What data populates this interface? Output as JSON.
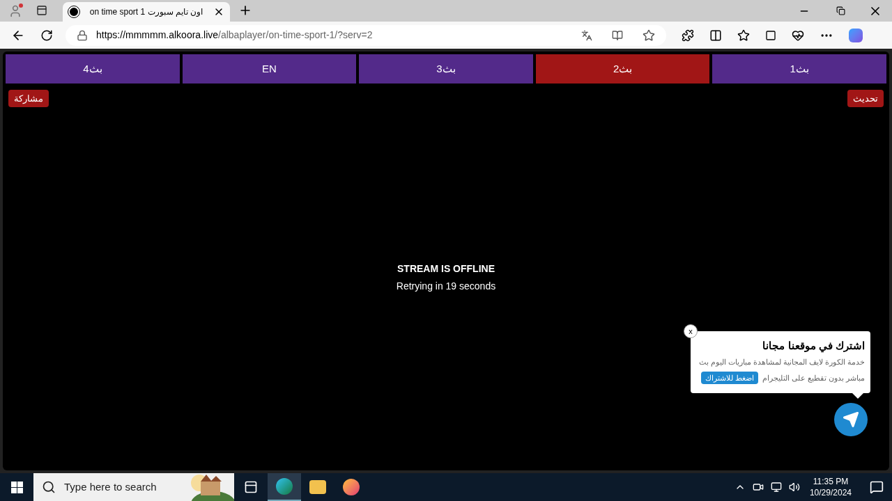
{
  "browser": {
    "tab": {
      "title": "on time sport 1 اون تايم سبورت"
    },
    "url": {
      "host": "https://mmmmm.alkoora.live",
      "path": "/albaplayer/on-time-sport-1/?serv=2"
    }
  },
  "servers": [
    {
      "label": "بث1",
      "selected": false
    },
    {
      "label": "بث2",
      "selected": true
    },
    {
      "label": "بث3",
      "selected": false
    },
    {
      "label": "EN",
      "selected": false
    },
    {
      "label": "بث4",
      "selected": false
    }
  ],
  "refresh_button": "تحديث",
  "share_button": "مشاركة",
  "player": {
    "status": "STREAM IS OFFLINE",
    "message": "Retrying in 19 seconds"
  },
  "popup": {
    "close": "x",
    "title": "اشترك في موقعنا مجانا",
    "body_lines": [
      "خدمة الكورة لايف المجانية لمشاهدة مباريات اليوم بث",
      "مباشر بدون تقطيع على التليجرام"
    ],
    "button": "اضغط للاشتراك"
  },
  "taskbar": {
    "search": {
      "placeholder": "Type here to search"
    },
    "time": "11:35 PM",
    "date": "10/29/2024"
  }
}
